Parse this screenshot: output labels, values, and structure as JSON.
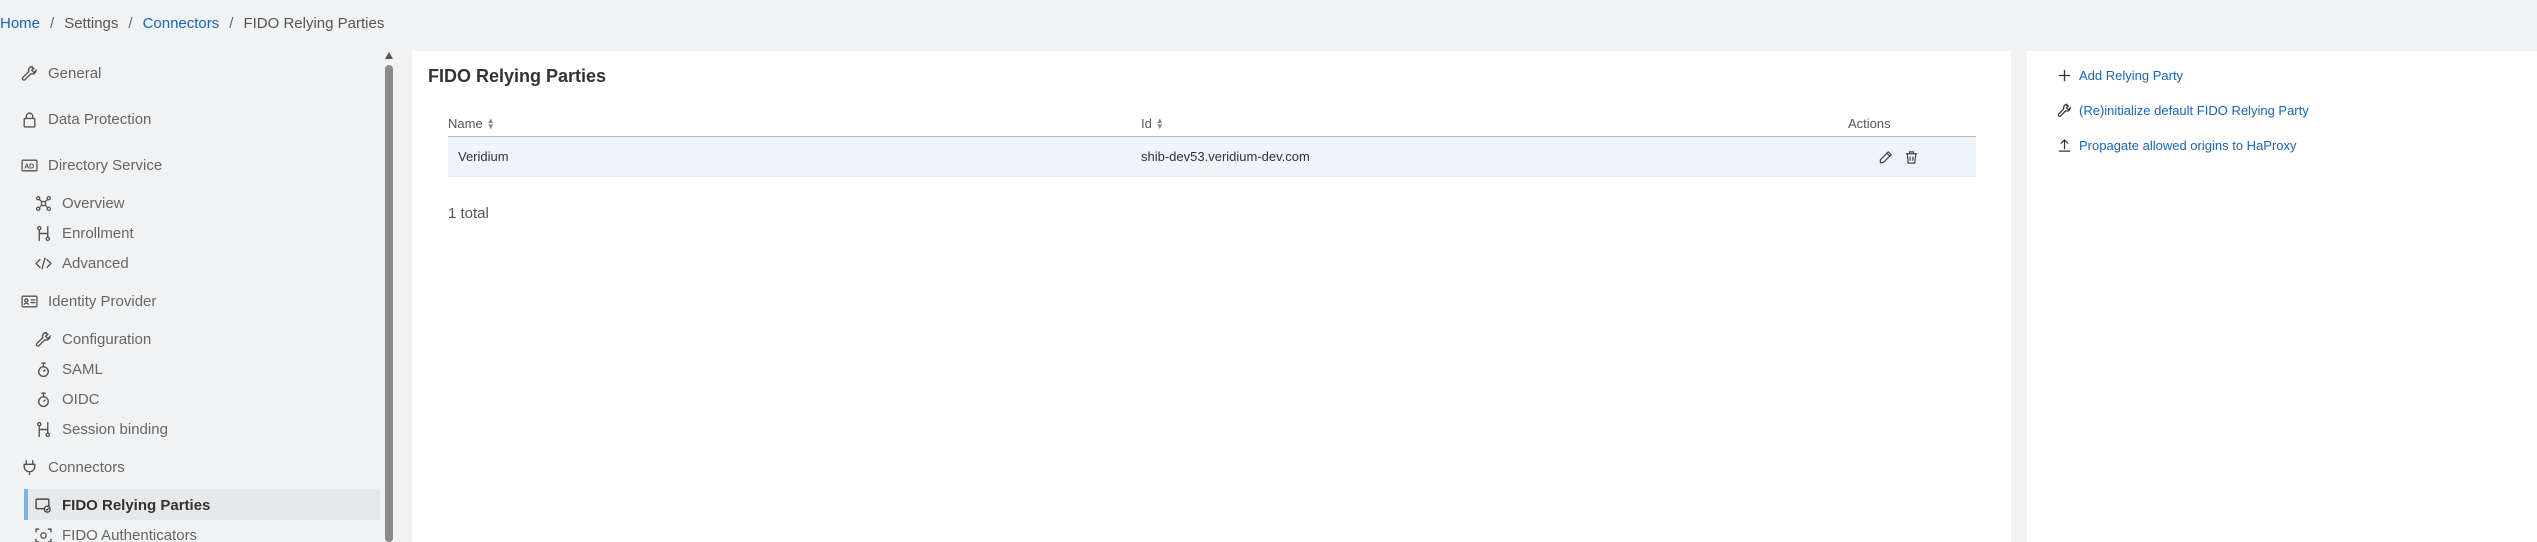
{
  "breadcrumb": {
    "home": "Home",
    "sep": "/",
    "settings": "Settings",
    "connectors": "Connectors",
    "current": "FIDO Relying Parties"
  },
  "sidebar": {
    "items": [
      {
        "label": "General",
        "icon": "wrench-icon"
      },
      {
        "label": "Data Protection",
        "icon": "lock-icon"
      },
      {
        "label": "Directory Service",
        "icon": "ad-icon"
      },
      {
        "label": "Overview",
        "icon": "network-icon"
      },
      {
        "label": "Enrollment",
        "icon": "workflow-icon"
      },
      {
        "label": "Advanced",
        "icon": "code-icon"
      },
      {
        "label": "Identity Provider",
        "icon": "id-card-icon"
      },
      {
        "label": "Configuration",
        "icon": "wrench-icon"
      },
      {
        "label": "SAML",
        "icon": "protocol-icon"
      },
      {
        "label": "OIDC",
        "icon": "protocol-icon"
      },
      {
        "label": "Session binding",
        "icon": "workflow-icon"
      },
      {
        "label": "Connectors",
        "icon": "plug-icon"
      },
      {
        "label": "FIDO Relying Parties",
        "icon": "relying-party-icon"
      },
      {
        "label": "FIDO Authenticators",
        "icon": "authenticator-icon"
      }
    ]
  },
  "main": {
    "title": "FIDO Relying Parties",
    "columns": {
      "name": "Name",
      "id": "Id",
      "actions": "Actions"
    },
    "rows": [
      {
        "name": "Veridium",
        "id": "shib-dev53.veridium-dev.com"
      }
    ],
    "total": "1 total"
  },
  "side_actions": {
    "add": "Add Relying Party",
    "reinit": "(Re)initialize default FIDO Relying Party",
    "propagate": "Propagate allowed origins to HaProxy"
  },
  "colors": {
    "accent": "#1565c0",
    "active_bar": "#7ab3e6",
    "row_bg": "#eef4fa"
  }
}
